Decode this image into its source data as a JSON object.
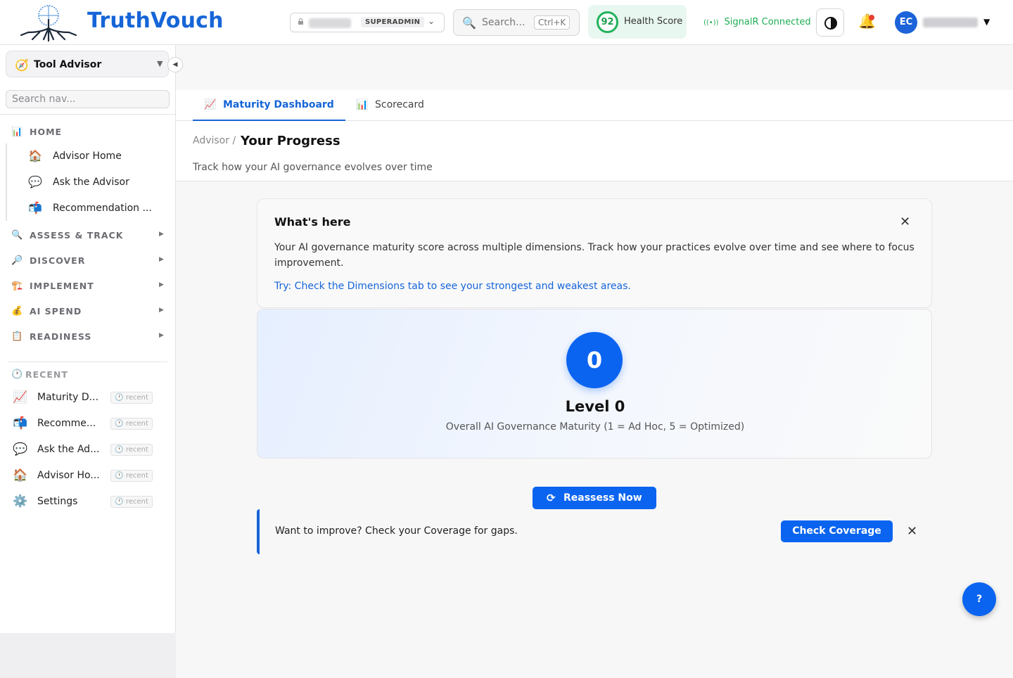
{
  "header": {
    "brand": "TruthVouch",
    "tenant_role": "SUPERADMIN",
    "search_placeholder": "Search...",
    "search_shortcut": "Ctrl+K",
    "health_score": "92",
    "health_label": "Health Score",
    "signal_status": "SignalR Connected",
    "user_initials": "EC"
  },
  "sidebar": {
    "tool": "Tool Advisor",
    "search_placeholder": "Search nav...",
    "sections": [
      {
        "label": "HOME"
      },
      {
        "label": "ASSESS & TRACK"
      },
      {
        "label": "DISCOVER"
      },
      {
        "label": "IMPLEMENT"
      },
      {
        "label": "AI SPEND"
      },
      {
        "label": "READINESS"
      }
    ],
    "home_items": [
      {
        "label": "Advisor Home"
      },
      {
        "label": "Ask the Advisor"
      },
      {
        "label": "Recommendation ..."
      }
    ],
    "recent_label": "RECENT",
    "recent_tag": "recent",
    "recent_items": [
      {
        "label": "Maturity D..."
      },
      {
        "label": "Recomme..."
      },
      {
        "label": "Ask the Ad..."
      },
      {
        "label": "Advisor Ho..."
      },
      {
        "label": "Settings"
      }
    ]
  },
  "tabs": [
    {
      "label": "Maturity Dashboard",
      "active": true
    },
    {
      "label": "Scorecard",
      "active": false
    }
  ],
  "page": {
    "breadcrumb": "Advisor /",
    "title": "Your Progress",
    "subtitle": "Track how your AI governance evolves over time"
  },
  "info": {
    "heading": "What's here",
    "body": "Your AI governance maturity score across multiple dimensions. Track how your practices evolve over time and see where to focus improvement.",
    "tip": "Try: Check the Dimensions tab to see your strongest and weakest areas."
  },
  "score": {
    "value": "0",
    "level": "Level 0",
    "caption": "Overall AI Governance Maturity (1 = Ad Hoc, 5 = Optimized)"
  },
  "actions": {
    "reassess": "Reassess Now",
    "coverage_text": "Want to improve? Check your Coverage for gaps.",
    "coverage_button": "Check Coverage",
    "help": "?"
  },
  "colors": {
    "accent": "#1665d8",
    "primary_button": "#0a64f0",
    "health_green": "#21b35c"
  }
}
